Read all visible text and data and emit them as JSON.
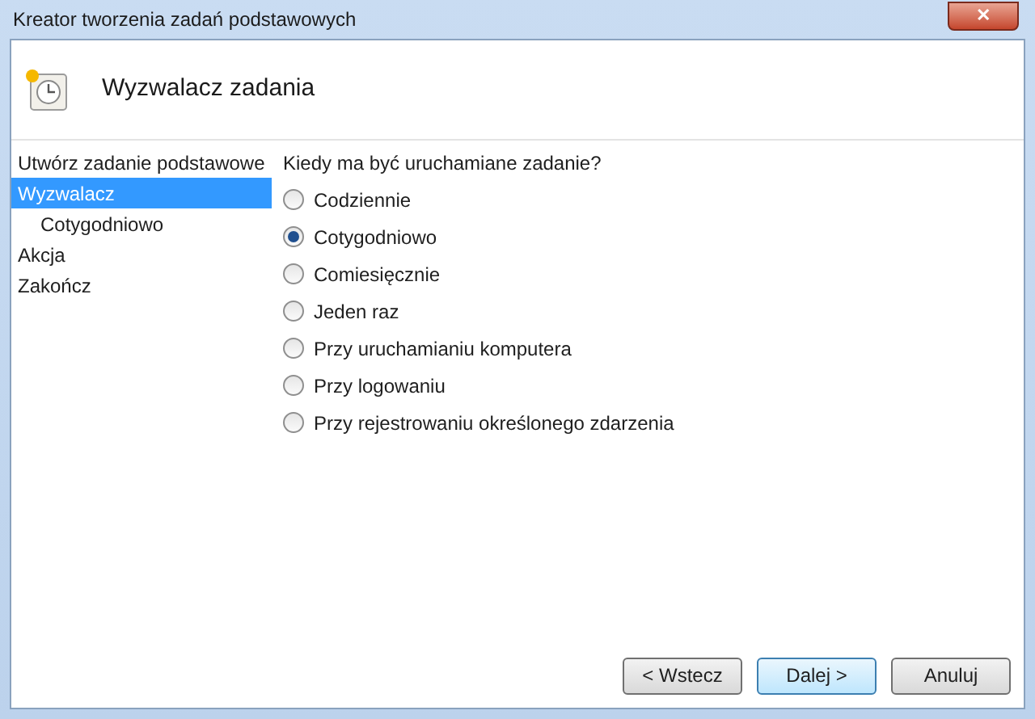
{
  "window": {
    "title": "Kreator tworzenia zadań podstawowych",
    "close": "✕"
  },
  "header": {
    "title": "Wyzwalacz zadania"
  },
  "sidebar": {
    "items": [
      {
        "label": "Utwórz zadanie podstawowe",
        "selected": false
      },
      {
        "label": "Wyzwalacz",
        "selected": true,
        "children": [
          {
            "label": "Cotygodniowo",
            "selected": false
          }
        ]
      },
      {
        "label": "Akcja",
        "selected": false
      },
      {
        "label": "Zakończ",
        "selected": false
      }
    ]
  },
  "question": "Kiedy ma być uruchamiane zadanie?",
  "options": [
    {
      "label": "Codziennie",
      "selected": false
    },
    {
      "label": "Cotygodniowo",
      "selected": true
    },
    {
      "label": "Comiesięcznie",
      "selected": false
    },
    {
      "label": "Jeden raz",
      "selected": false
    },
    {
      "label": "Przy uruchamianiu komputera",
      "selected": false
    },
    {
      "label": "Przy logowaniu",
      "selected": false
    },
    {
      "label": "Przy rejestrowaniu określonego zdarzenia",
      "selected": false
    }
  ],
  "buttons": [
    {
      "label": "< Wstecz",
      "default": false
    },
    {
      "label": "Dalej >",
      "default": true
    },
    {
      "label": "Anuluj",
      "default": false
    }
  ]
}
